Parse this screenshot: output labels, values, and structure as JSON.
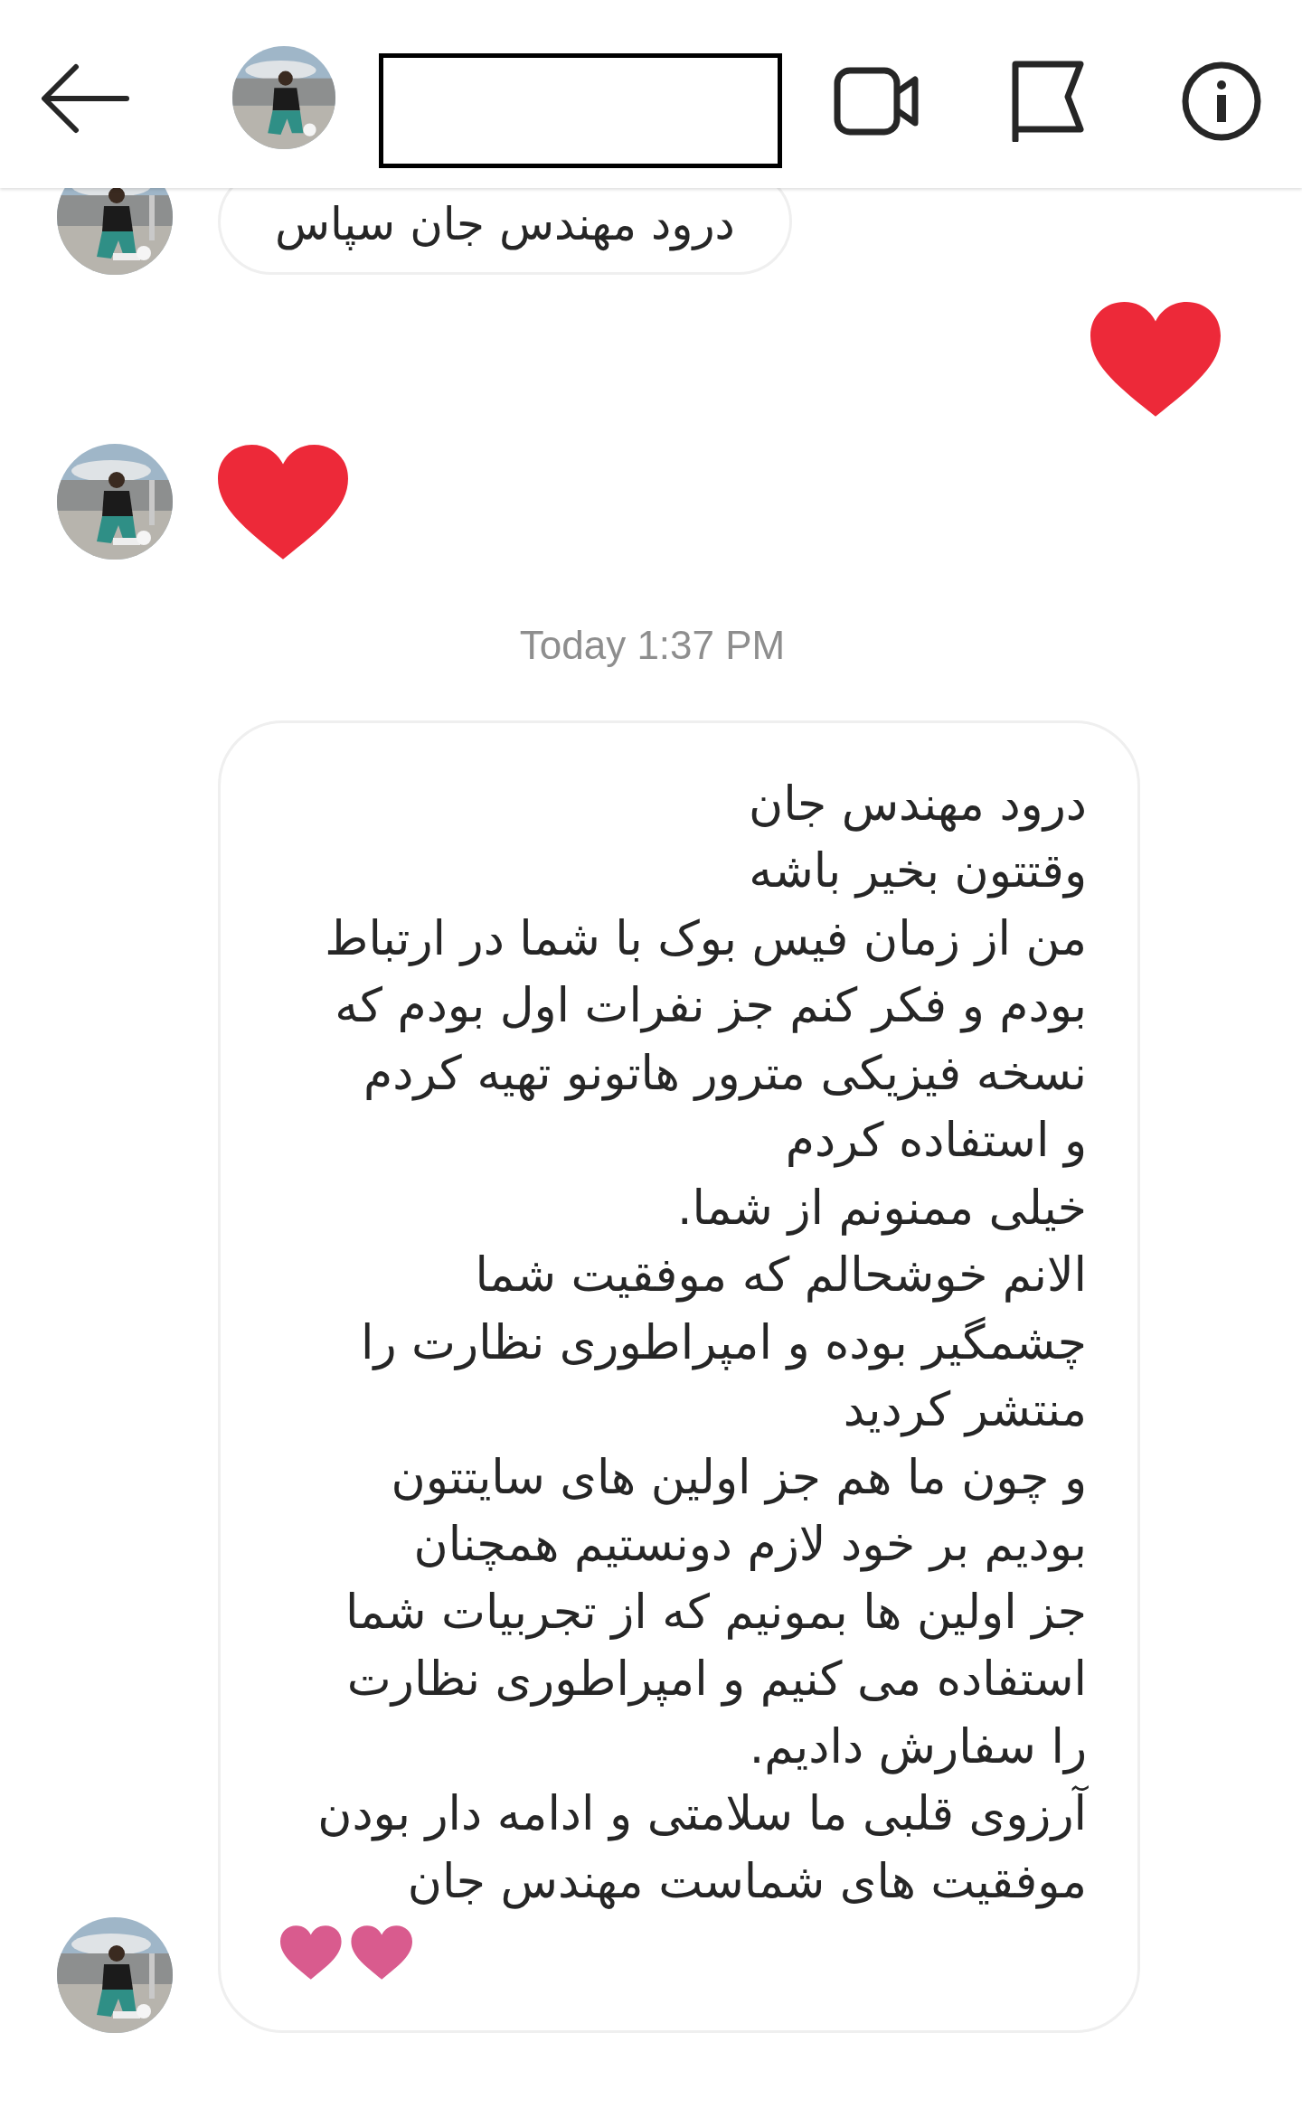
{
  "messages": [
    {
      "kind": "text",
      "sent_by_me": false,
      "text": "درود مهندس جان سپاس"
    },
    {
      "kind": "heart",
      "sent_by_me": true
    },
    {
      "kind": "heart",
      "sent_by_me": false
    },
    {
      "kind": "time",
      "text": "Today 1:37 PM"
    },
    {
      "kind": "text",
      "sent_by_me": false,
      "text": "درود مهندس جان\nوقتتون بخیر باشه\nمن از زمان فیس بوک با شما در ارتباط\nبودم و فکر کنم جز نفرات اول بودم که\nنسخه فیزیکی مترور هاتونو تهیه کردم\nو استفاده کردم\nخیلی ممنونم از شما.\nالانم خوشحالم که موفقیت شما\nچشمگیر بوده و امپراطوری نظارت را\nمنتشر کردید\nو چون ما هم جز اولین های سایتتون\nبودیم بر خود لازم دونستیم همچنان\nجز اولین ها بمونیم که از تجربیات شما\nاستفاده می کنیم و امپراطوری نظارت\nرا سفارش دادیم.\nآرزوی قلبی ما سلامتی و ادامه دار بودن\nموفقیت های شماست مهندس جان",
      "hearts": true
    }
  ]
}
